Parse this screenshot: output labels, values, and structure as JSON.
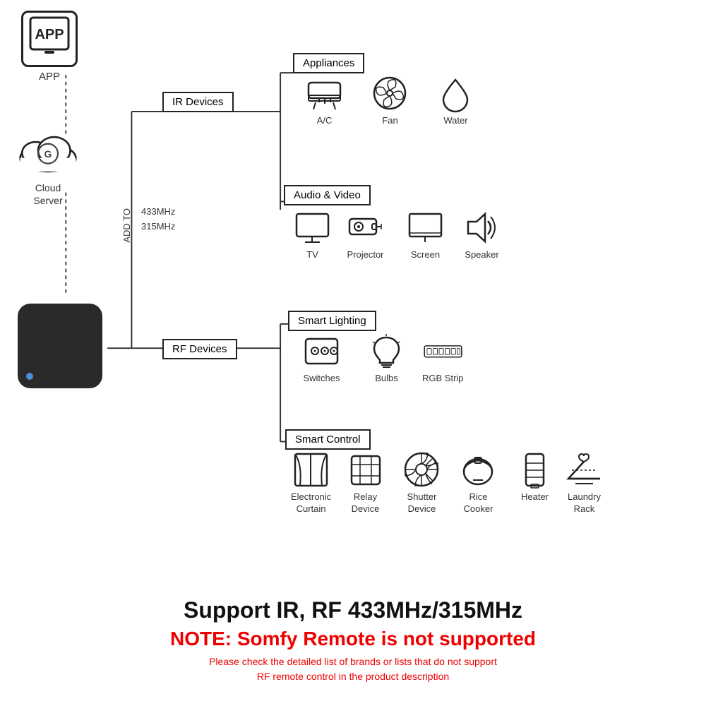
{
  "app": {
    "label": "APP",
    "icon_text": "APP"
  },
  "cloud": {
    "label_line1": "Cloud",
    "label_line2": "Server"
  },
  "connections": {
    "addto": "ADD TO",
    "freq1": "433MHz",
    "freq2": "315MHz"
  },
  "ir_box": "IR Devices",
  "rf_box": "RF Devices",
  "categories": {
    "appliances": "Appliances",
    "av": "Audio & Video",
    "lighting": "Smart Lighting",
    "control": "Smart Control"
  },
  "appliances_icons": [
    {
      "label": "A/C"
    },
    {
      "label": "Fan"
    },
    {
      "label": "Water"
    }
  ],
  "av_icons": [
    {
      "label": "TV"
    },
    {
      "label": "Projector"
    },
    {
      "label": "Screen"
    },
    {
      "label": "Speaker"
    }
  ],
  "lighting_icons": [
    {
      "label": "Switches"
    },
    {
      "label": "Bulbs"
    },
    {
      "label": "RGB Strip"
    }
  ],
  "control_icons": [
    {
      "label": "Electronic\nCurtain"
    },
    {
      "label": "Relay\nDevice"
    },
    {
      "label": "Shutter\nDevice"
    },
    {
      "label": "Rice\nCooker"
    },
    {
      "label": "Heater"
    },
    {
      "label": "Laundry\nRack"
    }
  ],
  "bottom": {
    "support_text": "Support IR, RF 433MHz/315MHz",
    "note_text": "NOTE: Somfy Remote is not supported",
    "disclaimer": "Please check the detailed list of brands or lists that do not support\nRF remote control in the product description"
  }
}
